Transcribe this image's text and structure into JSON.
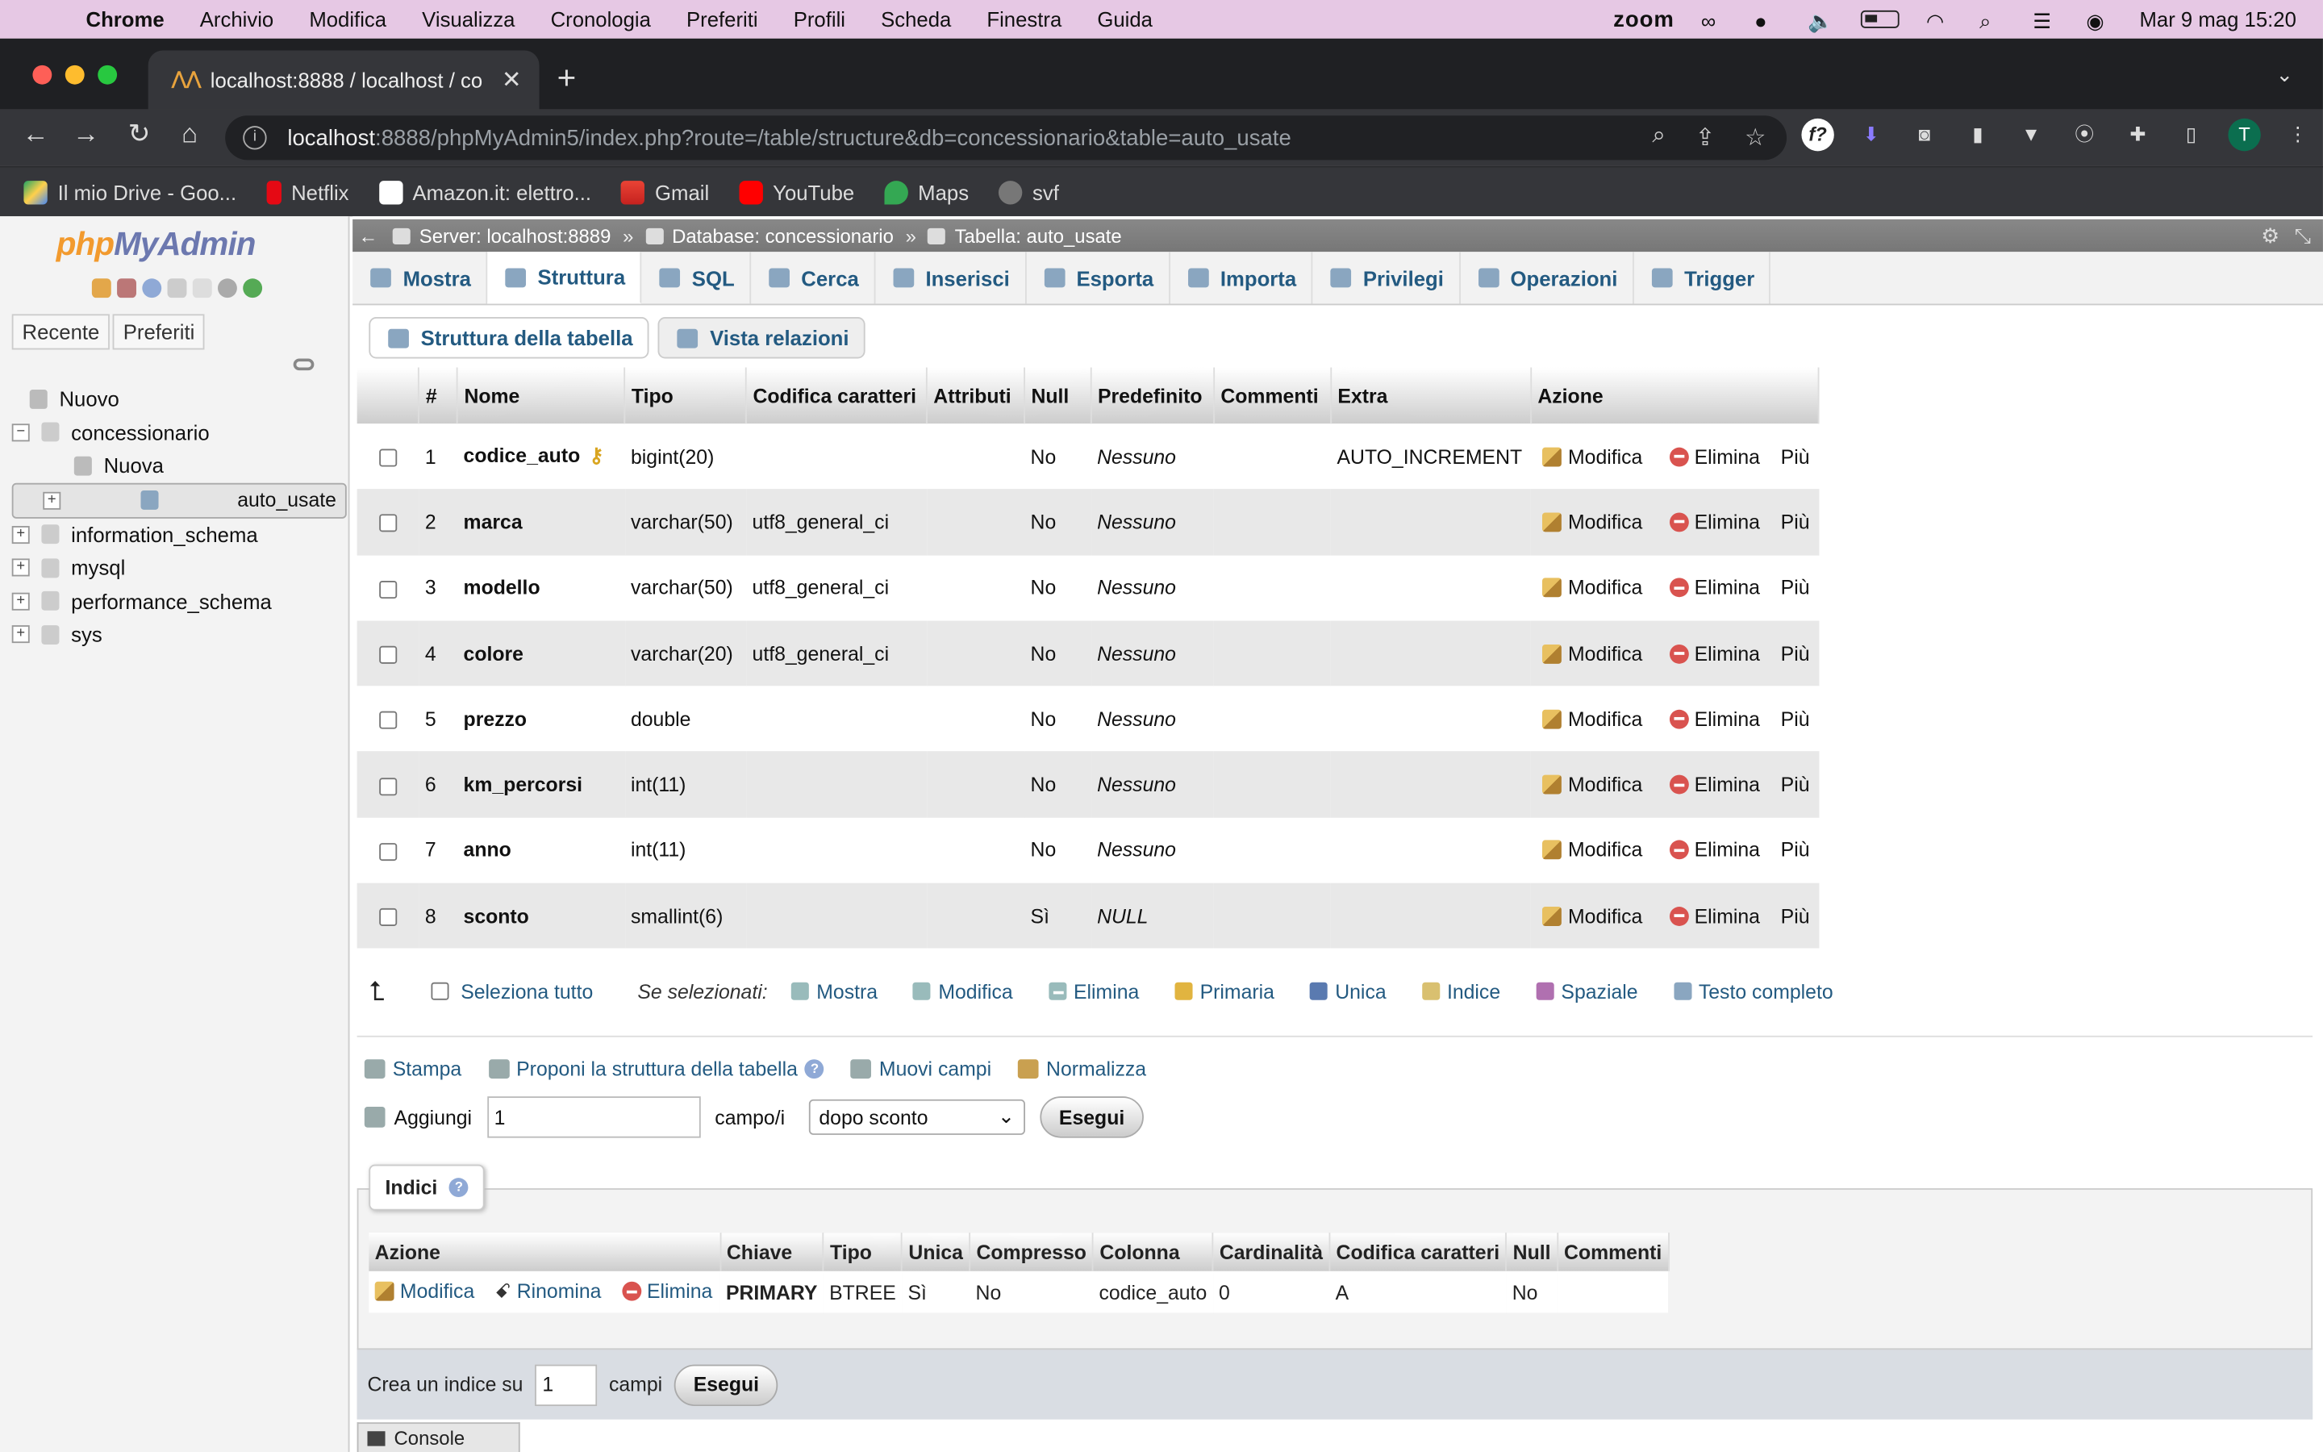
{
  "menubar": {
    "app": "Chrome",
    "items": [
      "Archivio",
      "Modifica",
      "Visualizza",
      "Cronologia",
      "Preferiti",
      "Profili",
      "Scheda",
      "Finestra",
      "Guida"
    ],
    "zoom": "zoom",
    "datetime": "Mar 9 mag  15:20"
  },
  "browser": {
    "tab_title": "localhost:8888 / localhost / co",
    "url_host": "localhost",
    "url_rest": ":8888/phpMyAdmin5/index.php?route=/table/structure&db=concessionario&table=auto_usate",
    "profile_initial": "T",
    "bookmarks": [
      "Il mio Drive - Goo...",
      "Netflix",
      "Amazon.it: elettro...",
      "Gmail",
      "YouTube",
      "Maps",
      "svf"
    ]
  },
  "sidebar": {
    "logo_a": "php",
    "logo_b": "MyAdmin",
    "tabs": [
      "Recente",
      "Preferiti"
    ],
    "tree": [
      {
        "label": "Nuovo"
      },
      {
        "label": "concessionario"
      },
      {
        "label": "Nuova"
      },
      {
        "label": "auto_usate"
      },
      {
        "label": "information_schema"
      },
      {
        "label": "mysql"
      },
      {
        "label": "performance_schema"
      },
      {
        "label": "sys"
      }
    ]
  },
  "breadcrumb": {
    "server": "Server: localhost:8889",
    "database": "Database: concessionario",
    "table": "Tabella: auto_usate",
    "sep": "»"
  },
  "top_tabs": [
    "Mostra",
    "Struttura",
    "SQL",
    "Cerca",
    "Inserisci",
    "Esporta",
    "Importa",
    "Privilegi",
    "Operazioni",
    "Trigger"
  ],
  "sub_tabs": [
    "Struttura della tabella",
    "Vista relazioni"
  ],
  "structure": {
    "headers": [
      "#",
      "Nome",
      "Tipo",
      "Codifica caratteri",
      "Attributi",
      "Null",
      "Predefinito",
      "Commenti",
      "Extra",
      "Azione"
    ],
    "action_labels": {
      "edit": "Modifica",
      "drop": "Elimina",
      "more": "Più"
    },
    "rows": [
      {
        "n": "1",
        "name": "codice_auto",
        "type": "bigint(20)",
        "coll": "",
        "attr": "",
        "null": "No",
        "default": "Nessuno",
        "comments": "",
        "extra": "AUTO_INCREMENT"
      },
      {
        "n": "2",
        "name": "marca",
        "type": "varchar(50)",
        "coll": "utf8_general_ci",
        "attr": "",
        "null": "No",
        "default": "Nessuno",
        "comments": "",
        "extra": ""
      },
      {
        "n": "3",
        "name": "modello",
        "type": "varchar(50)",
        "coll": "utf8_general_ci",
        "attr": "",
        "null": "No",
        "default": "Nessuno",
        "comments": "",
        "extra": ""
      },
      {
        "n": "4",
        "name": "colore",
        "type": "varchar(20)",
        "coll": "utf8_general_ci",
        "attr": "",
        "null": "No",
        "default": "Nessuno",
        "comments": "",
        "extra": ""
      },
      {
        "n": "5",
        "name": "prezzo",
        "type": "double",
        "coll": "",
        "attr": "",
        "null": "No",
        "default": "Nessuno",
        "comments": "",
        "extra": ""
      },
      {
        "n": "6",
        "name": "km_percorsi",
        "type": "int(11)",
        "coll": "",
        "attr": "",
        "null": "No",
        "default": "Nessuno",
        "comments": "",
        "extra": ""
      },
      {
        "n": "7",
        "name": "anno",
        "type": "int(11)",
        "coll": "",
        "attr": "",
        "null": "No",
        "default": "Nessuno",
        "comments": "",
        "extra": ""
      },
      {
        "n": "8",
        "name": "sconto",
        "type": "smallint(6)",
        "coll": "",
        "attr": "",
        "null": "Sì",
        "default": "NULL",
        "comments": "",
        "extra": ""
      }
    ]
  },
  "selection_bar": {
    "select_all": "Seleziona tutto",
    "with_selected": "Se selezionati:",
    "actions": [
      "Mostra",
      "Modifica",
      "Elimina",
      "Primaria",
      "Unica",
      "Indice",
      "Spaziale",
      "Testo completo"
    ]
  },
  "tools": {
    "print": "Stampa",
    "propose": "Proponi la struttura della tabella",
    "move": "Muovi campi",
    "normalize": "Normalizza",
    "add_label": "Aggiungi",
    "add_count": "1",
    "add_unit": "campo/i",
    "add_position": "dopo sconto",
    "go": "Esegui"
  },
  "indexes": {
    "legend": "Indici",
    "headers": [
      "Azione",
      "Chiave",
      "Tipo",
      "Unica",
      "Compresso",
      "Colonna",
      "Cardinalità",
      "Codifica caratteri",
      "Null",
      "Commenti"
    ],
    "actions": [
      "Modifica",
      "Rinomina",
      "Elimina"
    ],
    "row": {
      "key": "PRIMARY",
      "type": "BTREE",
      "unique": "Sì",
      "packed": "No",
      "column": "codice_auto",
      "cardinality": "0",
      "collation": "A",
      "null": "No",
      "comment": ""
    },
    "create_label": "Crea un indice su",
    "create_count": "1",
    "create_unit": "campi",
    "go": "Esegui"
  },
  "console": "Console"
}
